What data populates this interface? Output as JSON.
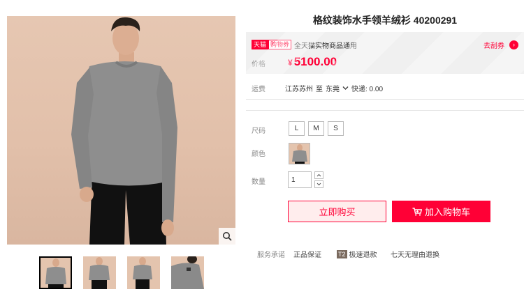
{
  "product": {
    "title": "格纹装饰水手领羊绒衫 40200291"
  },
  "price_panel": {
    "tag_tmall": "天猫",
    "tag_coupon": "购物券",
    "coupon_text": "全天猫实物商品通用",
    "get_coupon": "去刮券",
    "get_coupon_icon": "chevron-right-icon",
    "price_label": "价格",
    "currency": "¥",
    "price": "5100.00",
    "accent_color": "#ff0036"
  },
  "shipping": {
    "label": "运费",
    "from": "江苏苏州",
    "to_word": "至",
    "dest": "东莞",
    "fee": "快递: 0.00"
  },
  "options": {
    "size_label": "尺码",
    "sizes": [
      "L",
      "M",
      "S"
    ],
    "color_label": "颜色",
    "qty_label": "数量",
    "qty_value": "1"
  },
  "actions": {
    "buy_now": "立即购买",
    "add_cart": "加入购物车"
  },
  "services": {
    "label": "服务承诺",
    "item1": "正品保证",
    "item2_badge": "T2",
    "item2": "极速退款",
    "item3": "七天无理由退换"
  },
  "gallery": {
    "zoom_icon": "magnifier-icon",
    "thumb_count": 4
  }
}
